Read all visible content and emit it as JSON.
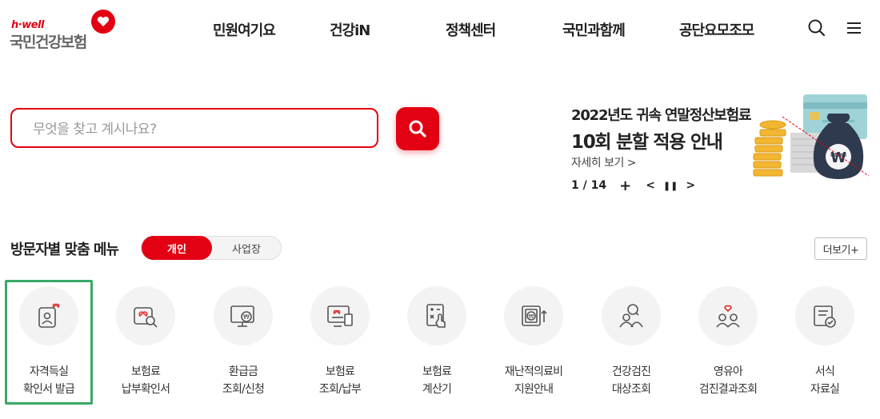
{
  "header": {
    "logo_sub": "h·well",
    "logo_main": "국민건강보험",
    "nav": [
      "민원여기요",
      "건강iN",
      "정책센터",
      "국민과함께",
      "공단요모조모"
    ]
  },
  "search": {
    "placeholder": "무엇을 찾고 계시나요?"
  },
  "banner": {
    "title_line1": "2022년도 귀속 연말정산보험료",
    "title_line2": "10회 분할 적용 안내",
    "more": "자세히 보기 >",
    "pager": "1 / 14",
    "add_symbol": "+",
    "prev_symbol": "<",
    "pause_symbol": "❚❚",
    "next_symbol": ">"
  },
  "custom_menu": {
    "title": "방문자별 맞춤 메뉴",
    "tab_personal": "개인",
    "tab_business": "사업장",
    "more_button": "더보기+",
    "items": [
      {
        "line1": "자격득실",
        "line2": "확인서 발급",
        "icon": "person-heart-doc-icon",
        "selected": true
      },
      {
        "line1": "보험료",
        "line2": "납부확인서",
        "icon": "heart-search-icon"
      },
      {
        "line1": "환급금",
        "line2": "조회/신청",
        "icon": "monitor-won-icon"
      },
      {
        "line1": "보험료",
        "line2": "조회/납부",
        "icon": "monitor-heart-receipt-icon"
      },
      {
        "line1": "보험료",
        "line2": "계산기",
        "icon": "calculator-hand-icon"
      },
      {
        "line1": "재난적의료비",
        "line2": "지원안내",
        "icon": "won-transfer-icon"
      },
      {
        "line1": "건강검진",
        "line2": "대상조회",
        "icon": "people-search-icon"
      },
      {
        "line1": "영유아",
        "line2": "검진결과조회",
        "icon": "children-heart-icon"
      },
      {
        "line1": "서식",
        "line2": "자료실",
        "icon": "document-check-icon"
      }
    ]
  },
  "colors": {
    "brand_red": "#e30012",
    "selection_green": "#3aa866",
    "icon_circle_bg": "#f3f3f3"
  }
}
